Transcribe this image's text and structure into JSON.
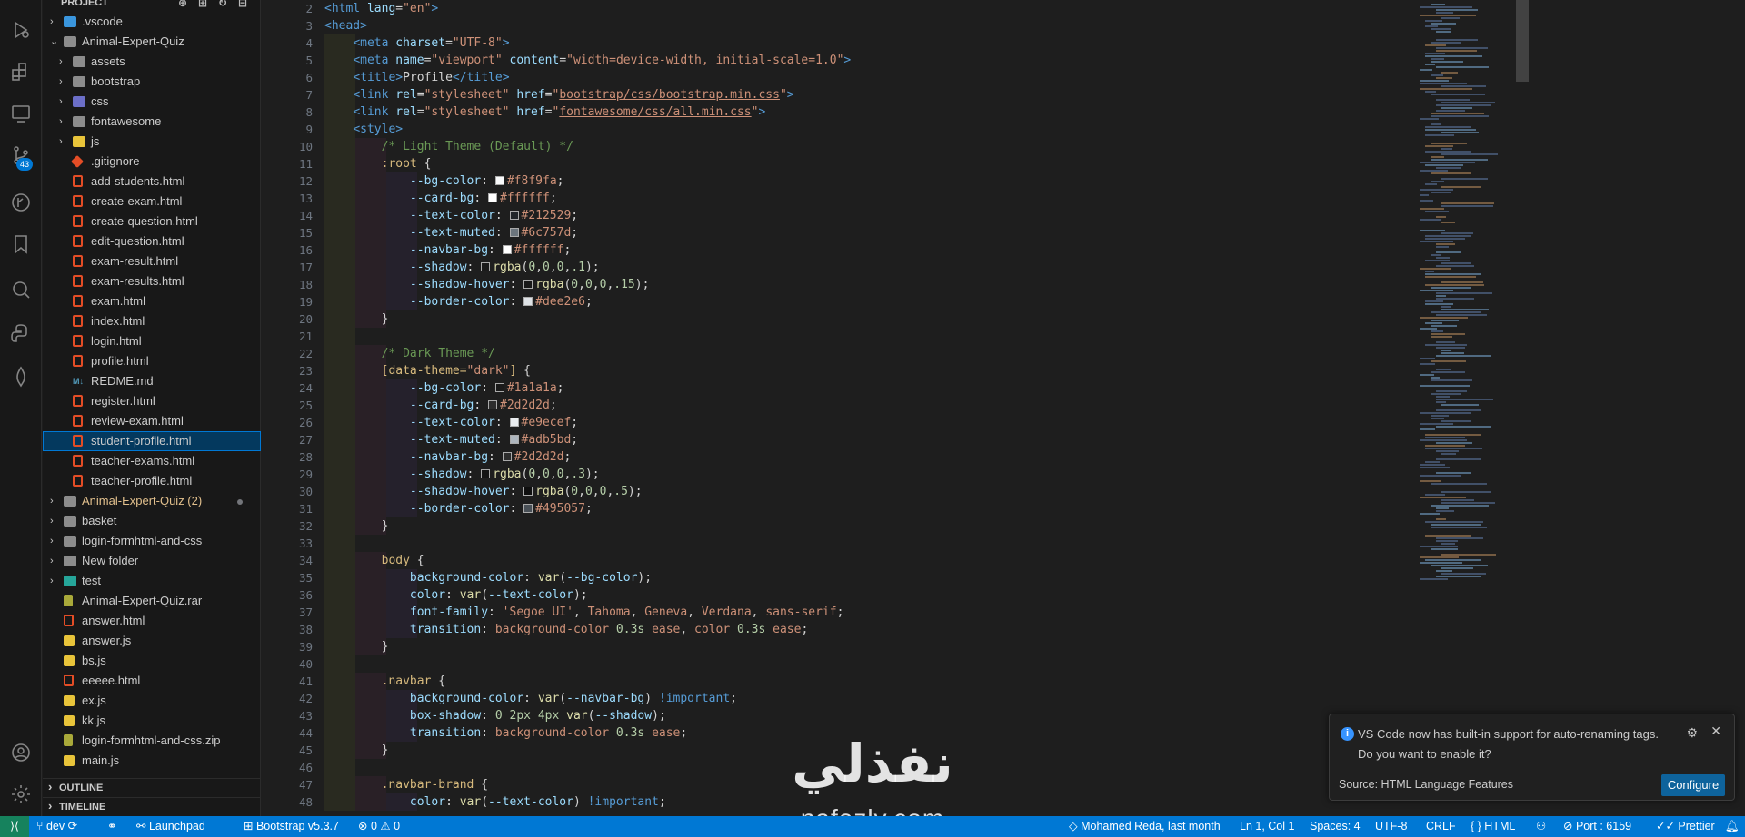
{
  "sidebar": {
    "title": "PROJECT",
    "items": [
      {
        "label": ".vscode",
        "type": "folder",
        "kind": "vs",
        "indent": 1
      },
      {
        "label": "Animal-Expert-Quiz",
        "type": "folder-open",
        "kind": "plain",
        "indent": 1
      },
      {
        "label": "assets",
        "type": "folder",
        "kind": "plain",
        "indent": 2
      },
      {
        "label": "bootstrap",
        "type": "folder",
        "kind": "plain",
        "indent": 2
      },
      {
        "label": "css",
        "type": "folder",
        "kind": "css",
        "indent": 2
      },
      {
        "label": "fontawesome",
        "type": "folder",
        "kind": "plain",
        "indent": 2
      },
      {
        "label": "js",
        "type": "folder",
        "kind": "js",
        "indent": 2
      },
      {
        "label": ".gitignore",
        "type": "file",
        "kind": "git",
        "indent": 2
      },
      {
        "label": "add-students.html",
        "type": "file",
        "kind": "html",
        "indent": 2
      },
      {
        "label": "create-exam.html",
        "type": "file",
        "kind": "html",
        "indent": 2
      },
      {
        "label": "create-question.html",
        "type": "file",
        "kind": "html",
        "indent": 2
      },
      {
        "label": "edit-question.html",
        "type": "file",
        "kind": "html",
        "indent": 2
      },
      {
        "label": "exam-result.html",
        "type": "file",
        "kind": "html",
        "indent": 2
      },
      {
        "label": "exam-results.html",
        "type": "file",
        "kind": "html",
        "indent": 2
      },
      {
        "label": "exam.html",
        "type": "file",
        "kind": "html",
        "indent": 2
      },
      {
        "label": "index.html",
        "type": "file",
        "kind": "html",
        "indent": 2
      },
      {
        "label": "login.html",
        "type": "file",
        "kind": "html",
        "indent": 2
      },
      {
        "label": "profile.html",
        "type": "file",
        "kind": "html",
        "indent": 2
      },
      {
        "label": "REDME.md",
        "type": "file",
        "kind": "md",
        "indent": 2
      },
      {
        "label": "register.html",
        "type": "file",
        "kind": "html",
        "indent": 2
      },
      {
        "label": "review-exam.html",
        "type": "file",
        "kind": "html",
        "indent": 2
      },
      {
        "label": "student-profile.html",
        "type": "file",
        "kind": "html",
        "indent": 2,
        "selected": true
      },
      {
        "label": "teacher-exams.html",
        "type": "file",
        "kind": "html",
        "indent": 2
      },
      {
        "label": "teacher-profile.html",
        "type": "file",
        "kind": "html",
        "indent": 2
      },
      {
        "label": "Animal-Expert-Quiz (2)",
        "type": "folder",
        "kind": "plain",
        "indent": 1,
        "modified": true
      },
      {
        "label": "basket",
        "type": "folder",
        "kind": "plain",
        "indent": 1
      },
      {
        "label": "login-formhtml-and-css",
        "type": "folder",
        "kind": "plain",
        "indent": 1
      },
      {
        "label": "New folder",
        "type": "folder",
        "kind": "plain",
        "indent": 1
      },
      {
        "label": "test",
        "type": "folder",
        "kind": "test",
        "indent": 1
      },
      {
        "label": "Animal-Expert-Quiz.rar",
        "type": "file",
        "kind": "zip",
        "indent": 1
      },
      {
        "label": "answer.html",
        "type": "file",
        "kind": "html",
        "indent": 1
      },
      {
        "label": "answer.js",
        "type": "file",
        "kind": "js",
        "indent": 1
      },
      {
        "label": "bs.js",
        "type": "file",
        "kind": "js",
        "indent": 1
      },
      {
        "label": "eeeee.html",
        "type": "file",
        "kind": "html",
        "indent": 1
      },
      {
        "label": "ex.js",
        "type": "file",
        "kind": "js",
        "indent": 1
      },
      {
        "label": "kk.js",
        "type": "file",
        "kind": "js",
        "indent": 1
      },
      {
        "label": "login-formhtml-and-css.zip",
        "type": "file",
        "kind": "zip",
        "indent": 1
      },
      {
        "label": "main.js",
        "type": "file",
        "kind": "js",
        "indent": 1
      }
    ],
    "outline_label": "OUTLINE",
    "timeline_label": "TIMELINE"
  },
  "activity": {
    "source_control_badge": "43"
  },
  "editor": {
    "line_numbers": [
      "2",
      "3",
      "4",
      "5",
      "6",
      "7",
      "8",
      "9",
      "10",
      "11",
      "12",
      "13",
      "14",
      "15",
      "16",
      "17",
      "18",
      "19",
      "20",
      "21",
      "22",
      "23",
      "24",
      "25",
      "26",
      "27",
      "28",
      "29",
      "30",
      "31",
      "32",
      "33",
      "34",
      "35",
      "36",
      "37",
      "38",
      "39",
      "40",
      "41",
      "42",
      "43",
      "44",
      "45",
      "46",
      "47",
      "48"
    ],
    "lines": [
      {
        "indent": 0,
        "html": "<span class='tag'>&lt;html</span> <span class='att'>lang</span>=<span class='str'>\"en\"</span><span class='tag'>&gt;</span>"
      },
      {
        "indent": 0,
        "html": "<span class='tag'>&lt;head&gt;</span>"
      },
      {
        "indent": 1,
        "html": "<span class='tag'>&lt;meta</span> <span class='att'>charset</span>=<span class='str'>\"UTF-8\"</span><span class='tag'>&gt;</span>"
      },
      {
        "indent": 1,
        "html": "<span class='tag'>&lt;meta</span> <span class='att'>name</span>=<span class='str'>\"viewport\"</span> <span class='att'>content</span>=<span class='str'>\"width=device-width, initial-scale=1.0\"</span><span class='tag'>&gt;</span>"
      },
      {
        "indent": 1,
        "html": "<span class='tag'>&lt;title&gt;</span>Profile<span class='tag'>&lt;/title&gt;</span>"
      },
      {
        "indent": 1,
        "html": "<span class='tag'>&lt;link</span> <span class='att'>rel</span>=<span class='str'>\"stylesheet\"</span> <span class='att'>href</span>=<span class='str'>\"<span class='ul'>bootstrap/css/bootstrap.min.css</span>\"</span><span class='tag'>&gt;</span>"
      },
      {
        "indent": 1,
        "html": "<span class='tag'>&lt;link</span> <span class='att'>rel</span>=<span class='str'>\"stylesheet\"</span> <span class='att'>href</span>=<span class='str'>\"<span class='ul'>fontawesome/css/all.min.css</span>\"</span><span class='tag'>&gt;</span>"
      },
      {
        "indent": 1,
        "html": "<span class='tag'>&lt;style&gt;</span>"
      },
      {
        "indent": 2,
        "html": "<span class='com'>/* Light Theme (Default) */</span>"
      },
      {
        "indent": 2,
        "html": "<span class='sel2'>:root</span> {"
      },
      {
        "indent": 3,
        "html": "<span class='prop'>--bg-color</span>: <span class='sw' style='background:#f8f9fa'></span><span class='kw'>#f8f9fa</span>;"
      },
      {
        "indent": 3,
        "html": "<span class='prop'>--card-bg</span>: <span class='sw' style='background:#ffffff'></span><span class='kw'>#ffffff</span>;"
      },
      {
        "indent": 3,
        "html": "<span class='prop'>--text-color</span>: <span class='sw' style='background:#212529'></span><span class='kw'>#212529</span>;"
      },
      {
        "indent": 3,
        "html": "<span class='prop'>--text-muted</span>: <span class='sw' style='background:#6c757d'></span><span class='kw'>#6c757d</span>;"
      },
      {
        "indent": 3,
        "html": "<span class='prop'>--navbar-bg</span>: <span class='sw' style='background:#ffffff'></span><span class='kw'>#ffffff</span>;"
      },
      {
        "indent": 3,
        "html": "<span class='prop'>--shadow</span>: <span class='sw' style='background:rgba(0,0,0,.1)'></span><span class='fn'>rgba</span>(<span class='num'>0</span>,<span class='num'>0</span>,<span class='num'>0</span>,<span class='num'>.1</span>);"
      },
      {
        "indent": 3,
        "html": "<span class='prop'>--shadow-hover</span>: <span class='sw' style='background:rgba(0,0,0,.15)'></span><span class='fn'>rgba</span>(<span class='num'>0</span>,<span class='num'>0</span>,<span class='num'>0</span>,<span class='num'>.15</span>);"
      },
      {
        "indent": 3,
        "html": "<span class='prop'>--border-color</span>: <span class='sw' style='background:#dee2e6'></span><span class='kw'>#dee2e6</span>;"
      },
      {
        "indent": 2,
        "html": "}"
      },
      {
        "indent": 1,
        "html": ""
      },
      {
        "indent": 2,
        "html": "<span class='com'>/* Dark Theme */</span>"
      },
      {
        "indent": 2,
        "html": "<span class='sel2'>[data-theme=<span class='str'>\"dark\"</span>]</span> {"
      },
      {
        "indent": 3,
        "html": "<span class='prop'>--bg-color</span>: <span class='sw' style='background:#1a1a1a'></span><span class='kw'>#1a1a1a</span>;"
      },
      {
        "indent": 3,
        "html": "<span class='prop'>--card-bg</span>: <span class='sw' style='background:#2d2d2d'></span><span class='kw'>#2d2d2d</span>;"
      },
      {
        "indent": 3,
        "html": "<span class='prop'>--text-color</span>: <span class='sw' style='background:#e9ecef'></span><span class='kw'>#e9ecef</span>;"
      },
      {
        "indent": 3,
        "html": "<span class='prop'>--text-muted</span>: <span class='sw' style='background:#adb5bd'></span><span class='kw'>#adb5bd</span>;"
      },
      {
        "indent": 3,
        "html": "<span class='prop'>--navbar-bg</span>: <span class='sw' style='background:#2d2d2d'></span><span class='kw'>#2d2d2d</span>;"
      },
      {
        "indent": 3,
        "html": "<span class='prop'>--shadow</span>: <span class='sw' style='background:rgba(0,0,0,.3)'></span><span class='fn'>rgba</span>(<span class='num'>0</span>,<span class='num'>0</span>,<span class='num'>0</span>,<span class='num'>.3</span>);"
      },
      {
        "indent": 3,
        "html": "<span class='prop'>--shadow-hover</span>: <span class='sw' style='background:rgba(0,0,0,.5)'></span><span class='fn'>rgba</span>(<span class='num'>0</span>,<span class='num'>0</span>,<span class='num'>0</span>,<span class='num'>.5</span>);"
      },
      {
        "indent": 3,
        "html": "<span class='prop'>--border-color</span>: <span class='sw' style='background:#495057'></span><span class='kw'>#495057</span>;"
      },
      {
        "indent": 2,
        "html": "}"
      },
      {
        "indent": 1,
        "html": ""
      },
      {
        "indent": 2,
        "html": "<span class='sel2'>body</span> {"
      },
      {
        "indent": 3,
        "html": "<span class='prop'>background-color</span>: <span class='fn'>var</span>(<span class='prop'>--bg-color</span>);"
      },
      {
        "indent": 3,
        "html": "<span class='prop'>color</span>: <span class='fn'>var</span>(<span class='prop'>--text-color</span>);"
      },
      {
        "indent": 3,
        "html": "<span class='prop'>font-family</span>: <span class='str'>'Segoe UI'</span>, <span class='kw'>Tahoma</span>, <span class='kw'>Geneva</span>, <span class='kw'>Verdana</span>, <span class='kw'>sans-serif</span>;"
      },
      {
        "indent": 3,
        "html": "<span class='prop'>transition</span>: <span class='kw'>background-color</span> <span class='num'>0.3s</span> <span class='kw'>ease</span>, <span class='kw'>color</span> <span class='num'>0.3s</span> <span class='kw'>ease</span>;"
      },
      {
        "indent": 2,
        "html": "}"
      },
      {
        "indent": 1,
        "html": ""
      },
      {
        "indent": 2,
        "html": "<span class='sel2'>.navbar</span> {"
      },
      {
        "indent": 3,
        "html": "<span class='prop'>background-color</span>: <span class='fn'>var</span>(<span class='prop'>--navbar-bg</span>) <span class='imp'>!important</span>;"
      },
      {
        "indent": 3,
        "html": "<span class='prop'>box-shadow</span>: <span class='num'>0</span> <span class='num'>2px</span> <span class='num'>4px</span> <span class='fn'>var</span>(<span class='prop'>--shadow</span>);"
      },
      {
        "indent": 3,
        "html": "<span class='prop'>transition</span>: <span class='kw'>background-color</span> <span class='num'>0.3s</span> <span class='kw'>ease</span>;"
      },
      {
        "indent": 2,
        "html": "}"
      },
      {
        "indent": 1,
        "html": ""
      },
      {
        "indent": 2,
        "html": "<span class='sel2'>.navbar-brand</span> {"
      },
      {
        "indent": 3,
        "html": "<span class='prop'>color</span>: <span class='fn'>var</span>(<span class='prop'>--text-color</span>) <span class='imp'>!important</span>;"
      }
    ]
  },
  "notification": {
    "message_line1": "VS Code now has built-in support for auto-renaming tags.",
    "message_line2": "Do you want to enable it?",
    "source": "Source: HTML Language Features",
    "button": "Configure"
  },
  "watermark": {
    "arabic": "نفذلي",
    "latin": "nafezly.com"
  },
  "statusbar": {
    "branch": "dev",
    "launchpad": "Launchpad",
    "bootstrap": "Bootstrap v5.3.7",
    "errors": "0",
    "warnings": "0",
    "blame": "Mohamed Reda, last month",
    "position": "Ln 1, Col 1",
    "spaces": "Spaces: 4",
    "encoding": "UTF-8",
    "eol": "CRLF",
    "language": "HTML",
    "port": "Port : 6159",
    "prettier": "Prettier"
  }
}
